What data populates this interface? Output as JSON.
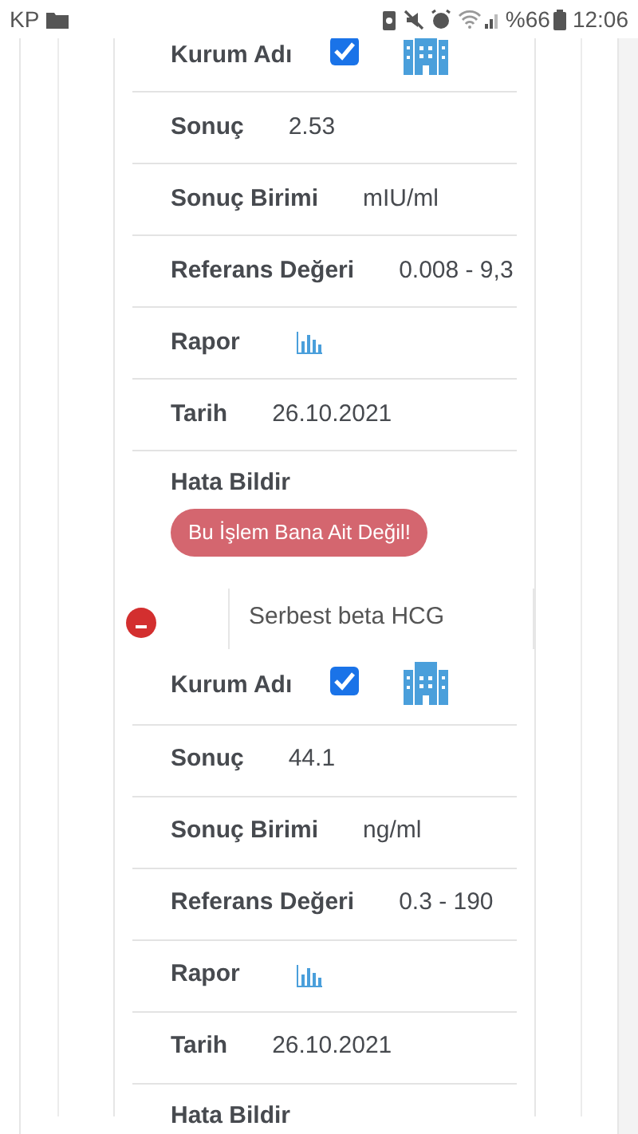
{
  "status_bar": {
    "carrier": "KP",
    "battery": "%66",
    "time": "12:06"
  },
  "records": [
    {
      "rows": [
        {
          "kind": "institution",
          "label": "Kurum Adı",
          "checked": true
        },
        {
          "kind": "text",
          "label": "Sonuç",
          "value": "2.53"
        },
        {
          "kind": "text",
          "label": "Sonuç Birimi",
          "value": "mIU/ml"
        },
        {
          "kind": "text",
          "label": "Referans Değeri",
          "value": "0.008 - 9,3"
        },
        {
          "kind": "report",
          "label": "Rapor"
        },
        {
          "kind": "text",
          "label": "Tarih",
          "value": "26.10.2021"
        },
        {
          "kind": "action",
          "label": "Hata Bildir",
          "button": "Bu İşlem Bana Ait Değil!"
        }
      ]
    },
    {
      "test_name": "Serbest beta HCG",
      "expanded": true,
      "rows": [
        {
          "kind": "institution",
          "label": "Kurum Adı",
          "checked": true
        },
        {
          "kind": "text",
          "label": "Sonuç",
          "value": "44.1"
        },
        {
          "kind": "text",
          "label": "Sonuç Birimi",
          "value": "ng/ml"
        },
        {
          "kind": "text",
          "label": "Referans Değeri",
          "value": "0.3 - 190"
        },
        {
          "kind": "report",
          "label": "Rapor"
        },
        {
          "kind": "text",
          "label": "Tarih",
          "value": "26.10.2021"
        },
        {
          "kind": "action",
          "label": "Hata Bildir"
        }
      ]
    }
  ]
}
